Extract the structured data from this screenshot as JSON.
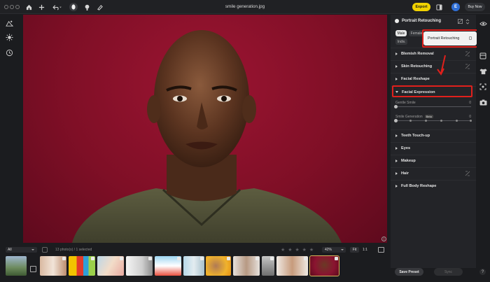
{
  "app": {
    "file_title": "smile generation.jpg",
    "export_label": "Export",
    "buy_now_label": "Buy Now",
    "avatar_initial": "E",
    "accent_color": "#f1d200"
  },
  "panel": {
    "header_title": "Portrait Retouching",
    "chips": [
      "Male",
      "Female",
      "Indiv."
    ],
    "popover_text": "Portrait Retouching",
    "sections": [
      {
        "label": "Blemish Removal",
        "expanded": false
      },
      {
        "label": "Skin Retouching",
        "expanded": false
      },
      {
        "label": "Facial Reshape",
        "expanded": false
      },
      {
        "label": "Facial Expression",
        "expanded": true
      },
      {
        "label": "Teeth Touch-up",
        "expanded": false
      },
      {
        "label": "Eyes",
        "expanded": false
      },
      {
        "label": "Makeup",
        "expanded": false
      },
      {
        "label": "Hair",
        "expanded": false
      },
      {
        "label": "Full Body Reshape",
        "expanded": false
      }
    ],
    "sliders": [
      {
        "label": "Gentle Smile",
        "value": "0",
        "level": 0
      },
      {
        "label": "Smile Generation",
        "value": "0",
        "level": 0,
        "badge": "Beta"
      }
    ],
    "save_preset_label": "Save Preset",
    "sync_label": "Sync",
    "highlight_color": "#e0201c"
  },
  "filmstrip": {
    "filter_value": "All",
    "photo_count": "13 photo(s) / 1 selected",
    "stars": "★ ★ ★ ★ ★",
    "zoom_value": "42%",
    "fit_label": "Fit",
    "one_to_one_label": "1:1",
    "selected_index": 12
  }
}
